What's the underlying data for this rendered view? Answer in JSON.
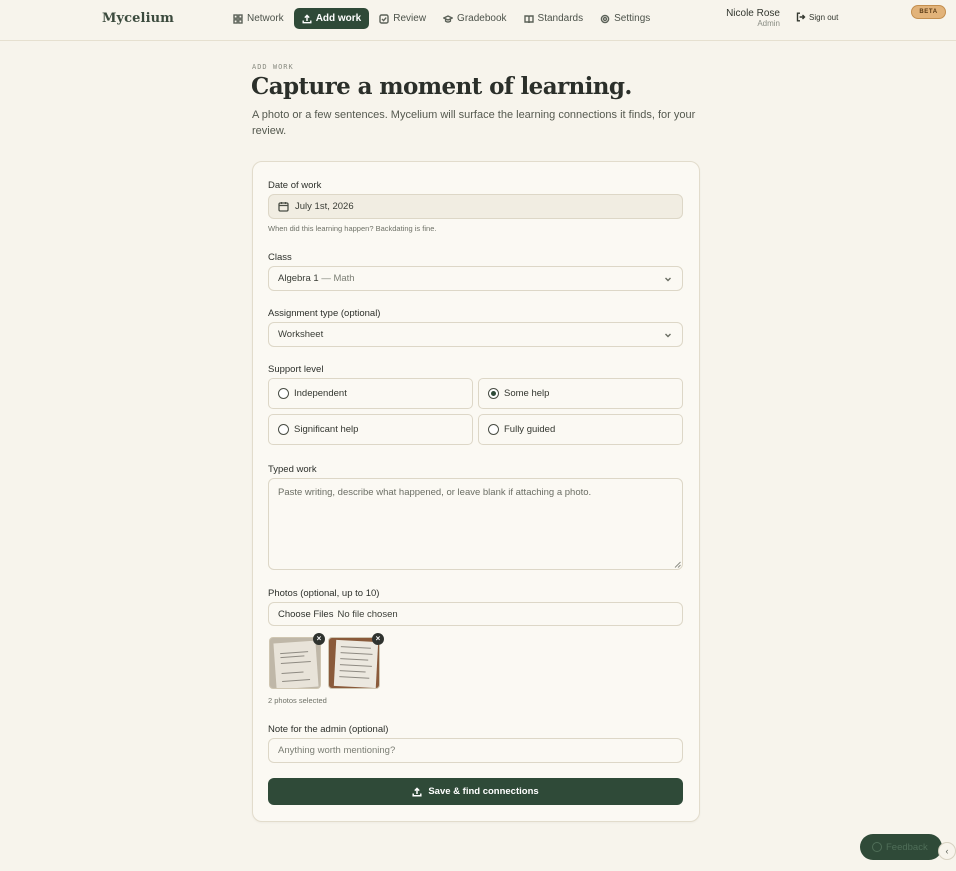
{
  "header": {
    "brand": "Mycelium",
    "nav": [
      {
        "label": "Network",
        "icon": "grid-icon"
      },
      {
        "label": "Add work",
        "icon": "upload-icon",
        "active": true
      },
      {
        "label": "Review",
        "icon": "check-square-icon"
      },
      {
        "label": "Gradebook",
        "icon": "graduation-cap-icon"
      },
      {
        "label": "Standards",
        "icon": "book-open-icon"
      },
      {
        "label": "Settings",
        "icon": "gear-icon"
      }
    ],
    "user_name": "Nicole Rose",
    "user_role": "Admin",
    "signout_label": "Sign out",
    "beta_badge": "BETA"
  },
  "intro": {
    "eyebrow": "ADD WORK",
    "title": "Capture a moment of learning.",
    "subtitle": "A photo or a few sentences. Mycelium will surface the learning connections it finds, for your review."
  },
  "form": {
    "date": {
      "label": "Date of work",
      "value": "July 1st, 2026",
      "hint": "When did this learning happen? Backdating is fine."
    },
    "class": {
      "label": "Class",
      "value_main": "Algebra 1",
      "value_sub": "— Math"
    },
    "assignment": {
      "label": "Assignment type (optional)",
      "value": "Worksheet"
    },
    "support": {
      "label": "Support level",
      "options": [
        "Independent",
        "Some help",
        "Significant help",
        "Fully guided"
      ],
      "selected": "Some help"
    },
    "typed": {
      "label": "Typed work",
      "placeholder": "Paste writing, describe what happened, or leave blank if attaching a photo."
    },
    "photos": {
      "label": "Photos (optional, up to 10)",
      "button": "Choose Files",
      "status": "No file chosen",
      "count_text": "2 photos selected",
      "remove_glyph": "×"
    },
    "note": {
      "label": "Note for the admin (optional)",
      "placeholder": "Anything worth mentioning?"
    },
    "submit_label": "Save & find connections"
  },
  "feedback_label": "Feedback",
  "collapse_glyph": "‹",
  "colors": {
    "accent": "#2f4a38",
    "background": "#f7f4ec",
    "beta": "#e2b37a"
  }
}
